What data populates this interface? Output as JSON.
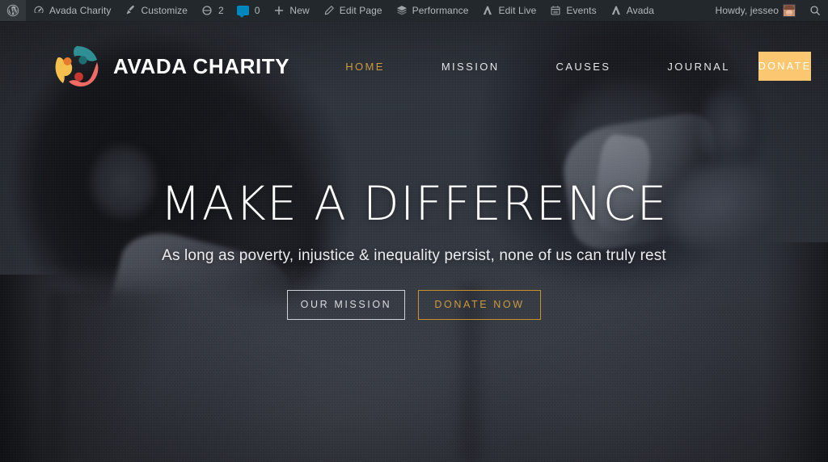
{
  "admin_bar": {
    "left_items": [
      {
        "id": "wp-logo",
        "icon": "wordpress-icon",
        "label": ""
      },
      {
        "id": "site-name",
        "icon": "dashboard-icon",
        "label": "Avada Charity"
      },
      {
        "id": "customize",
        "icon": "paintbrush-icon",
        "label": "Customize"
      },
      {
        "id": "updates",
        "icon": "updates-icon",
        "label": "",
        "count": "2"
      },
      {
        "id": "comments",
        "icon": "comment-bubble-icon",
        "label": "",
        "count": "0"
      },
      {
        "id": "new-content",
        "icon": "plus-icon",
        "label": "New"
      },
      {
        "id": "edit-page",
        "icon": "pencil-icon",
        "label": "Edit Page"
      },
      {
        "id": "performance",
        "icon": "layers-icon",
        "label": "Performance"
      },
      {
        "id": "edit-live",
        "icon": "avada-icon",
        "label": "Edit Live"
      },
      {
        "id": "events",
        "icon": "calendar-icon",
        "label": "Events"
      },
      {
        "id": "avada",
        "icon": "avada-icon",
        "label": "Avada"
      }
    ],
    "account": {
      "greeting": "Howdy, jesseo",
      "avatar_name": "user-avatar"
    },
    "search": {
      "icon": "search-icon"
    },
    "bar_color": "#23282d",
    "text_color": "#b4b9be",
    "bubble_color": "#0087be"
  },
  "site_header": {
    "logo_name": "avada-charity-logo",
    "brand_title": "AVADA CHARITY",
    "nav": [
      {
        "label": "HOME",
        "active": true
      },
      {
        "label": "MISSION",
        "active": false
      },
      {
        "label": "CAUSES",
        "active": false
      },
      {
        "label": "JOURNAL",
        "active": false
      }
    ],
    "donate_label": "DONATE",
    "donate_bg": "#fbc770",
    "accent_gold": "#c89b43"
  },
  "hero": {
    "title": "MAKE A DIFFERENCE",
    "subtitle": "As long as poverty, injustice & inequality persist, none of us can truly rest",
    "buttons": [
      {
        "label": "OUR MISSION",
        "style": "outline-light",
        "color": "#d8dadd"
      },
      {
        "label": "DONATE NOW",
        "style": "outline-gold",
        "color": "#c89b43"
      }
    ],
    "background_name": "two-children-photo",
    "background_tone": "#3a4049"
  }
}
